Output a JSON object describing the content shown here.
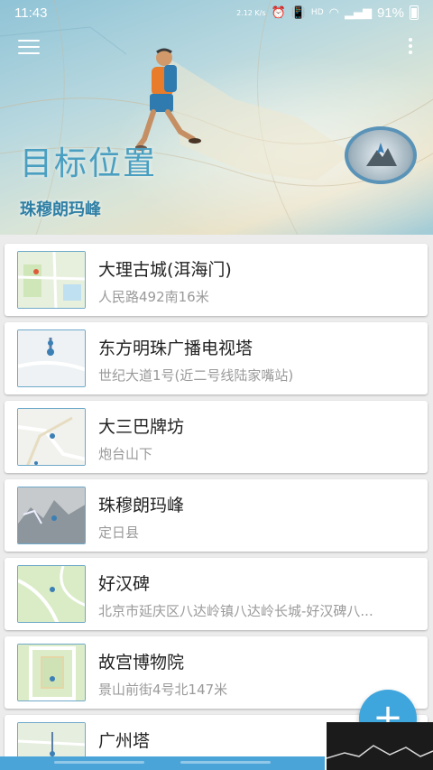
{
  "status_bar": {
    "time": "11:43",
    "speed": "2.12 K/s",
    "network": "HD",
    "battery": "91%"
  },
  "header": {
    "title": "目标位置",
    "subtitle": "珠穆朗玛峰"
  },
  "locations": [
    {
      "name": "大理古城(洱海门)",
      "address": "人民路492南16米"
    },
    {
      "name": "东方明珠广播电视塔",
      "address": "世纪大道1号(近二号线陆家嘴站)"
    },
    {
      "name": "大三巴牌坊",
      "address": "炮台山下"
    },
    {
      "name": "珠穆朗玛峰",
      "address": "定日县"
    },
    {
      "name": "好汉碑",
      "address": "北京市延庆区八达岭镇八达岭长城-好汉碑八..."
    },
    {
      "name": "故宫博物院",
      "address": "景山前街4号北147米"
    },
    {
      "name": "广州塔",
      "address": ""
    }
  ],
  "fab": {
    "icon": "plus-icon",
    "label": "+"
  },
  "colors": {
    "accent": "#3fa6dd",
    "title": "#4a9fc1",
    "subtitle": "#2f7fa5"
  }
}
